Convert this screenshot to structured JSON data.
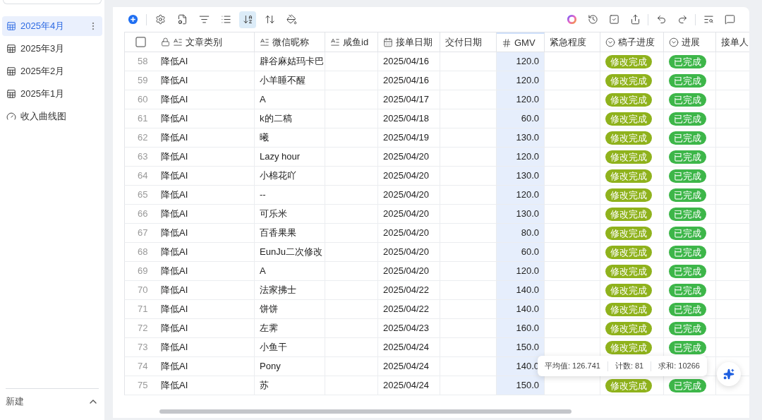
{
  "sidebar": {
    "items": [
      {
        "label": "2025年4月",
        "kind": "table",
        "selected": true
      },
      {
        "label": "2025年3月",
        "kind": "table",
        "selected": false
      },
      {
        "label": "2025年2月",
        "kind": "table",
        "selected": false
      },
      {
        "label": "2025年1月",
        "kind": "table",
        "selected": false
      },
      {
        "label": "收入曲线图",
        "kind": "dashboard",
        "selected": false
      }
    ],
    "new_label": "新建"
  },
  "toolbar": {
    "left": [
      {
        "kind": "add",
        "selected": false
      },
      {
        "kind": "settings",
        "selected": false
      },
      {
        "kind": "form",
        "selected": false
      },
      {
        "kind": "filter",
        "selected": false
      },
      {
        "kind": "list",
        "selected": false
      },
      {
        "kind": "sort",
        "selected": true
      },
      {
        "kind": "row-height",
        "selected": false
      },
      {
        "kind": "fill",
        "selected": false
      }
    ],
    "right": [
      {
        "kind": "assistant"
      },
      {
        "kind": "history"
      },
      {
        "kind": "check"
      },
      {
        "kind": "share"
      },
      {
        "kind": "undo"
      },
      {
        "kind": "redo"
      },
      {
        "kind": "find"
      },
      {
        "kind": "comment"
      }
    ]
  },
  "header_checkbox": {
    "checked": false
  },
  "columns": [
    {
      "label": "文章类别",
      "kind": "text",
      "locked": true,
      "selected": false
    },
    {
      "label": "微信昵称",
      "kind": "text",
      "locked": false,
      "selected": false
    },
    {
      "label": "咸鱼id",
      "kind": "text",
      "locked": false,
      "selected": false
    },
    {
      "label": "接单日期",
      "kind": "date",
      "locked": false,
      "selected": false
    },
    {
      "label": "交付日期",
      "kind": "plain",
      "locked": false,
      "selected": false
    },
    {
      "label": "GMV",
      "kind": "number",
      "locked": false,
      "selected": true
    },
    {
      "label": "紧急程度",
      "kind": "plain",
      "locked": false,
      "selected": false
    },
    {
      "label": "稿子进度",
      "kind": "select",
      "locked": false,
      "selected": false,
      "color": "#8fb21c"
    },
    {
      "label": "进展",
      "kind": "select",
      "locked": false,
      "selected": false,
      "color": "#3db649"
    },
    {
      "label": "接单人",
      "kind": "plain",
      "locked": false,
      "selected": false
    }
  ],
  "rows": [
    {
      "number": "58",
      "cells": [
        "降低AI",
        "辟谷麻姑玛卡巴",
        null,
        "2025/04/16",
        null,
        "120.0",
        null,
        "修改完成",
        "已完成",
        null
      ]
    },
    {
      "number": "59",
      "cells": [
        "降低AI",
        "小羊睡不醒",
        null,
        "2025/04/16",
        null,
        "120.0",
        null,
        "修改完成",
        "已完成",
        null
      ]
    },
    {
      "number": "60",
      "cells": [
        "降低AI",
        "A",
        null,
        "2025/04/17",
        null,
        "120.0",
        null,
        "修改完成",
        "已完成",
        null
      ]
    },
    {
      "number": "61",
      "cells": [
        "降低AI",
        "k的二稿",
        null,
        "2025/04/18",
        null,
        "60.0",
        null,
        "修改完成",
        "已完成",
        null
      ]
    },
    {
      "number": "62",
      "cells": [
        "降低AI",
        "曦",
        null,
        "2025/04/19",
        null,
        "130.0",
        null,
        "修改完成",
        "已完成",
        null
      ]
    },
    {
      "number": "63",
      "cells": [
        "降低AI",
        "Lazy hour",
        null,
        "2025/04/20",
        null,
        "120.0",
        null,
        "修改完成",
        "已完成",
        null
      ]
    },
    {
      "number": "64",
      "cells": [
        "降低AI",
        "小棉花吖",
        null,
        "2025/04/20",
        null,
        "130.0",
        null,
        "修改完成",
        "已完成",
        null
      ]
    },
    {
      "number": "65",
      "cells": [
        "降低AI",
        "--",
        null,
        "2025/04/20",
        null,
        "120.0",
        null,
        "修改完成",
        "已完成",
        null
      ]
    },
    {
      "number": "66",
      "cells": [
        "降低AI",
        "可乐米",
        null,
        "2025/04/20",
        null,
        "130.0",
        null,
        "修改完成",
        "已完成",
        null
      ]
    },
    {
      "number": "67",
      "cells": [
        "降低AI",
        "百香果果",
        null,
        "2025/04/20",
        null,
        "80.0",
        null,
        "修改完成",
        "已完成",
        null
      ]
    },
    {
      "number": "68",
      "cells": [
        "降低AI",
        "EunJu二次修改",
        null,
        "2025/04/20",
        null,
        "60.0",
        null,
        "修改完成",
        "已完成",
        null
      ]
    },
    {
      "number": "69",
      "cells": [
        "降低AI",
        "A",
        null,
        "2025/04/20",
        null,
        "120.0",
        null,
        "修改完成",
        "已完成",
        null
      ]
    },
    {
      "number": "70",
      "cells": [
        "降低AI",
        "法家拂士",
        null,
        "2025/04/22",
        null,
        "140.0",
        null,
        "修改完成",
        "已完成",
        null
      ]
    },
    {
      "number": "71",
      "cells": [
        "降低AI",
        "饼饼",
        null,
        "2025/04/22",
        null,
        "140.0",
        null,
        "修改完成",
        "已完成",
        null
      ]
    },
    {
      "number": "72",
      "cells": [
        "降低AI",
        "左霁",
        null,
        "2025/04/23",
        null,
        "160.0",
        null,
        "修改完成",
        "已完成",
        null
      ]
    },
    {
      "number": "73",
      "cells": [
        "降低AI",
        "小鱼干",
        null,
        "2025/04/24",
        null,
        "150.0",
        null,
        "修改完成",
        "已完成",
        null
      ]
    },
    {
      "number": "74",
      "cells": [
        "降低AI",
        "Pony",
        null,
        "2025/04/24",
        null,
        "140.0",
        null,
        null,
        null,
        null
      ]
    },
    {
      "number": "75",
      "cells": [
        "降低AI",
        "苏",
        null,
        "2025/04/24",
        null,
        "150.0",
        null,
        "修改完成",
        "已完成",
        null
      ]
    }
  ],
  "summary": {
    "average": "平均值: 126.741",
    "count": "计数: 81",
    "sum": "求和: 10266"
  }
}
